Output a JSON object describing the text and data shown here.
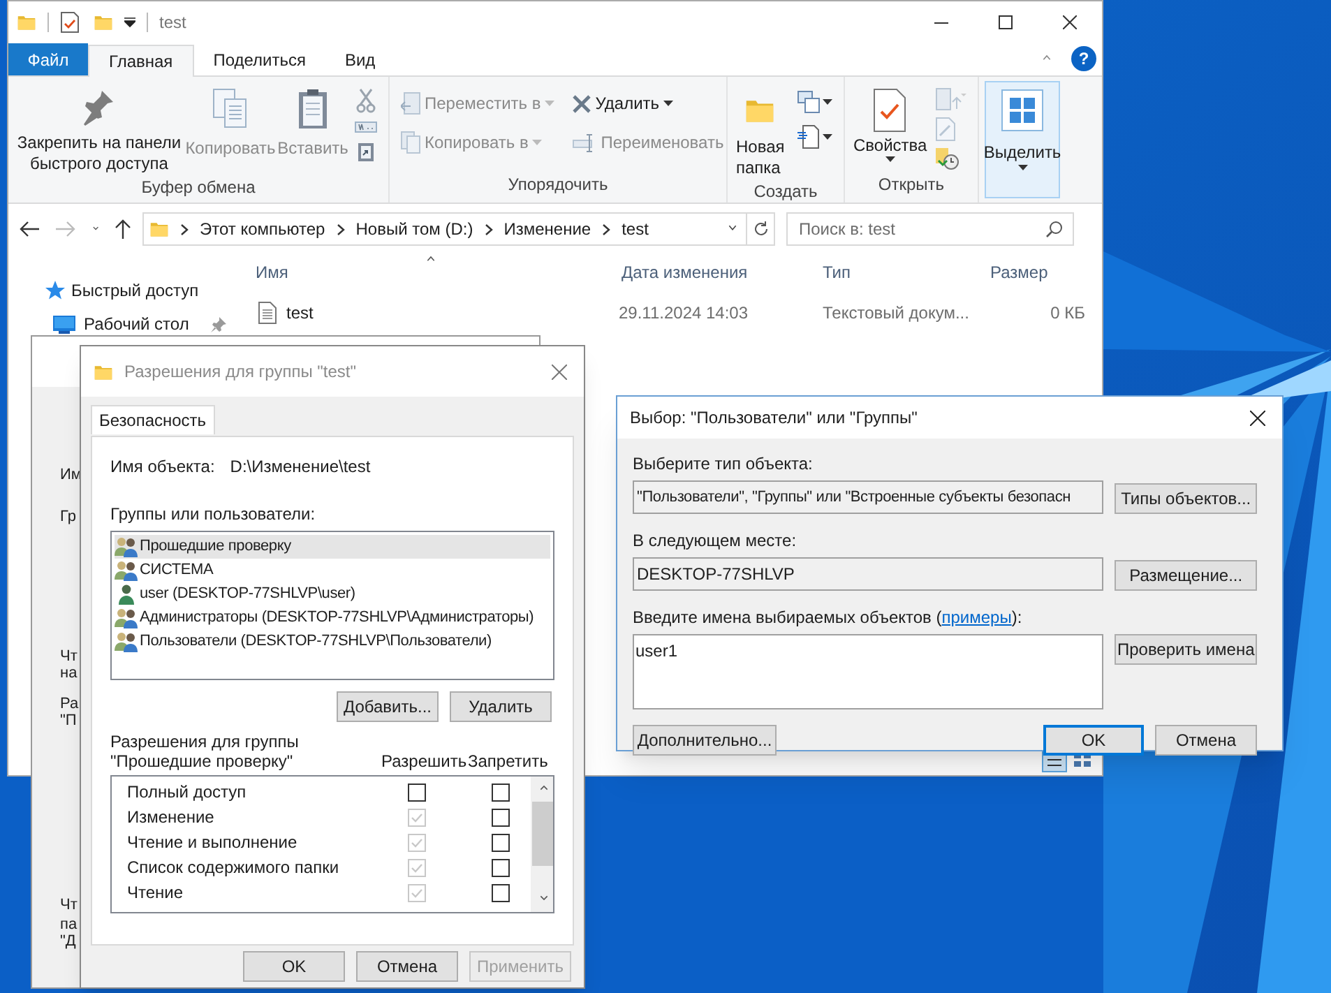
{
  "explorer": {
    "title": "test",
    "menu_tabs": [
      {
        "label": "Файл",
        "kind": "file",
        "selected": false
      },
      {
        "label": "Главная",
        "kind": "tab",
        "selected": true
      },
      {
        "label": "Поделиться",
        "kind": "tab",
        "selected": false
      },
      {
        "label": "Вид",
        "kind": "tab",
        "selected": false
      }
    ],
    "help_label": "?",
    "ribbon": {
      "clipboard": {
        "label": "Буфер обмена",
        "pin": {
          "label": "Закрепить на панели быстрого доступа",
          "disabled": false
        },
        "copy": {
          "label": "Копировать",
          "disabled": true
        },
        "paste": {
          "label": "Вставить",
          "disabled": true
        }
      },
      "organize": {
        "label": "Упорядочить",
        "move_to": {
          "label": "Переместить в",
          "disabled": true
        },
        "copy_to": {
          "label": "Копировать в",
          "disabled": true
        },
        "delete": {
          "label": "Удалить",
          "disabled": false
        },
        "rename": {
          "label": "Переименовать",
          "disabled": true
        }
      },
      "new": {
        "label": "Создать",
        "new_folder": {
          "label": "Новая папка",
          "disabled": false
        }
      },
      "open": {
        "label": "Открыть",
        "properties": {
          "label": "Свойства",
          "disabled": false
        }
      },
      "select": {
        "label": "Выделить",
        "highlighted": true
      }
    },
    "address": [
      "Этот компьютер",
      "Новый том (D:)",
      "Изменение",
      "test"
    ],
    "search": {
      "placeholder": "Поиск в: test"
    },
    "nav_items": [
      {
        "label": "Быстрый доступ",
        "kind": "quick_access",
        "pinned": false
      },
      {
        "label": "Рабочий стол",
        "kind": "desktop",
        "pinned": true
      }
    ],
    "columns": [
      {
        "label": "Имя",
        "sorted": true
      },
      {
        "label": "Дата изменения",
        "sorted": false
      },
      {
        "label": "Тип",
        "sorted": false
      },
      {
        "label": "Размер",
        "sorted": false
      }
    ],
    "files": [
      {
        "name": "test",
        "date": "29.11.2024 14:03",
        "type": "Текстовый докум...",
        "size": "0 КБ"
      }
    ]
  },
  "properties_window": {
    "fragments": [
      "Им",
      "Гр",
      "Чт",
      "на",
      "Ра",
      "\"П",
      "Чт",
      "па",
      "\"Д"
    ]
  },
  "permissions_dialog": {
    "title": "Разрешения для группы \"test\"",
    "tab": "Безопасность",
    "object_label": "Имя объекта:",
    "object_value": "D:\\Изменение\\test",
    "groups_label": "Группы или пользователи:",
    "principals": [
      {
        "name": "Прошедшие проверку",
        "kind": "group",
        "selected": true
      },
      {
        "name": "СИСТЕМА",
        "kind": "group",
        "selected": false
      },
      {
        "name": "user (DESKTOP-77SHLVP\\user)",
        "kind": "user",
        "selected": false
      },
      {
        "name": "Администраторы (DESKTOP-77SHLVP\\Администраторы)",
        "kind": "group",
        "selected": false
      },
      {
        "name": "Пользователи (DESKTOP-77SHLVP\\Пользователи)",
        "kind": "group",
        "selected": false
      }
    ],
    "add_button": "Добавить...",
    "remove_button": "Удалить",
    "permissions_label": [
      "Разрешения для группы",
      "\"Прошедшие проверку\""
    ],
    "allow_header": "Разрешить",
    "deny_header": "Запретить",
    "permissions": [
      {
        "name": "Полный доступ",
        "allow_checked": false,
        "allow_disabled": false,
        "deny_checked": false
      },
      {
        "name": "Изменение",
        "allow_checked": true,
        "allow_disabled": true,
        "deny_checked": false
      },
      {
        "name": "Чтение и выполнение",
        "allow_checked": true,
        "allow_disabled": true,
        "deny_checked": false
      },
      {
        "name": "Список содержимого папки",
        "allow_checked": true,
        "allow_disabled": true,
        "deny_checked": false
      },
      {
        "name": "Чтение",
        "allow_checked": true,
        "allow_disabled": true,
        "deny_checked": false
      }
    ],
    "buttons": [
      {
        "label": "OK",
        "disabled": false
      },
      {
        "label": "Отмена",
        "disabled": false
      },
      {
        "label": "Применить",
        "disabled": true
      }
    ]
  },
  "select_dialog": {
    "title": "Выбор: \"Пользователи\" или \"Группы\"",
    "type_label": "Выберите тип объекта:",
    "type_value": "\"Пользователи\", \"Группы\" или \"Встроенные субъекты безопасн",
    "type_button": "Типы объектов...",
    "location_label": "В следующем месте:",
    "location_value": "DESKTOP-77SHLVP",
    "location_button": "Размещение...",
    "names_label": {
      "before": "Введите имена выбираемых объектов (",
      "link": "примеры",
      "after": "):"
    },
    "names_value": "user1",
    "check_button": "Проверить имена",
    "advanced_button": "Дополнительно...",
    "ok_button": "OK",
    "cancel_button": "Отмена"
  }
}
